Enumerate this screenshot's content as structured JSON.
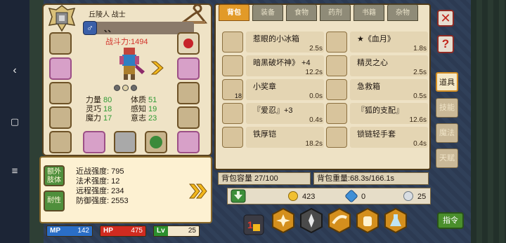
{
  "character": {
    "name": "丘陵人 战士",
    "gender_text": "、、",
    "power": "战斗力:1494",
    "stats": [
      {
        "label": "力量",
        "value": "80"
      },
      {
        "label": "体质",
        "value": "51"
      },
      {
        "label": "灵巧",
        "value": "18"
      },
      {
        "label": "感知",
        "value": "19"
      },
      {
        "label": "魔力",
        "value": "17"
      },
      {
        "label": "意志",
        "value": "23"
      }
    ]
  },
  "defense": {
    "tags": [
      "额外肢体",
      "耐性"
    ],
    "lines": [
      "近战强度: 795",
      "法术强度: 12",
      "远程强度: 234",
      "防御强度: 2553"
    ]
  },
  "bars": {
    "mp": {
      "label": "MP",
      "value": "142"
    },
    "hp": {
      "label": "HP",
      "value": "475"
    },
    "lv": {
      "label": "Lv",
      "value": "25"
    }
  },
  "inventory": {
    "tabs": [
      "背包",
      "装备",
      "食物",
      "药剂",
      "书籍",
      "杂物"
    ],
    "items": [
      {
        "name": "惹眼的小冰箱",
        "time": "2.5s"
      },
      {
        "name": "★《血月》",
        "time": "1.8s"
      },
      {
        "name": "暗黑破坏神》 +4",
        "time": "12.2s"
      },
      {
        "name": "精灵之心",
        "time": "2.5s"
      },
      {
        "name": "小奖章",
        "time": "0.0s"
      },
      {
        "name": "急救箱",
        "time": "0.5s"
      },
      {
        "name": "『爱忍』+3",
        "time": "0.4s"
      },
      {
        "name": "『狐的支配』",
        "time": "12.6s"
      },
      {
        "name": "铁厚铠",
        "time": "18.2s"
      },
      {
        "name": "锁链轻手套",
        "time": "0.4s"
      }
    ],
    "medal_count": "18",
    "capacity": "背包容量 27/100",
    "weight": "背包重量:68.3s/166.1s"
  },
  "side_tabs": [
    "道具",
    "技能",
    "魔法",
    "天赋"
  ],
  "currency": {
    "gold": "423",
    "gems": "0",
    "platinum": "25"
  },
  "command_label": "指令",
  "colors": {
    "mp": "#2a6ec7",
    "hp": "#d12b20",
    "lv": "#2c8f2e",
    "tab_active": "#e29a28"
  }
}
